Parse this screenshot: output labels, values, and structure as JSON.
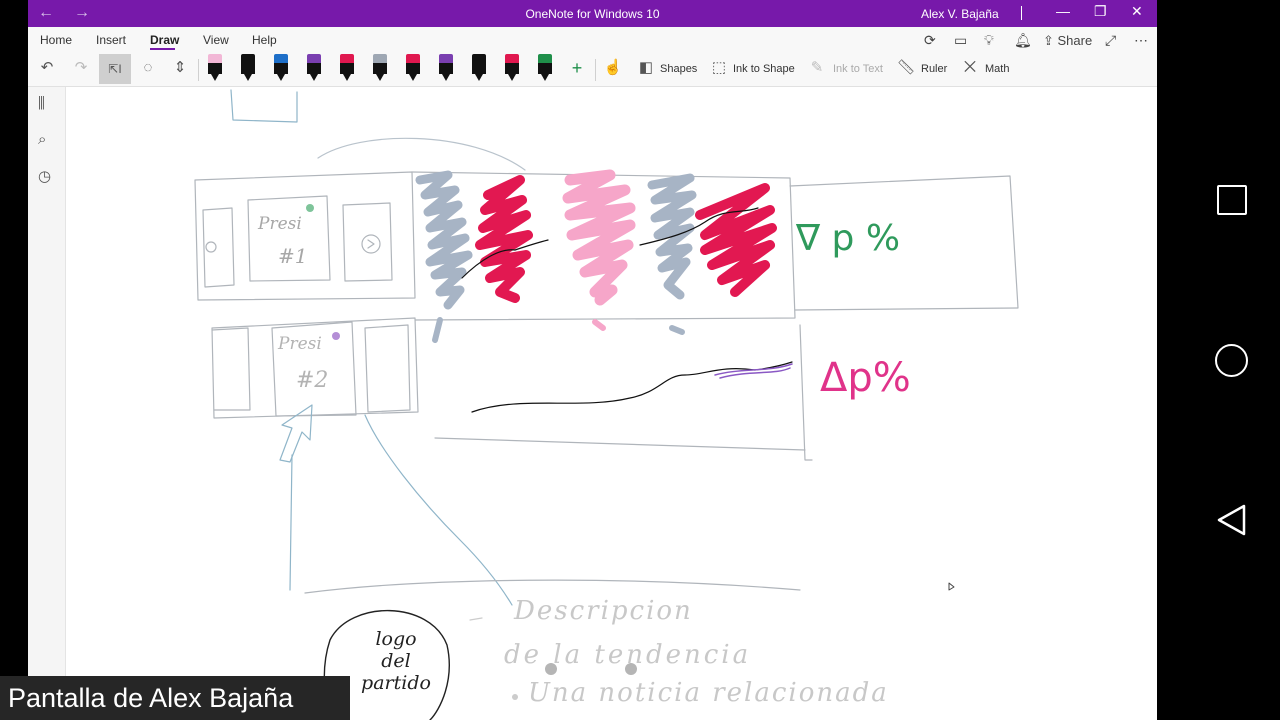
{
  "window": {
    "title": "OneNote for Windows 10",
    "user": "Alex V. Bajaña",
    "back_glyph": "←",
    "forward_glyph": "→",
    "minimize_glyph": "—",
    "restore_glyph": "❐",
    "close_glyph": "✕"
  },
  "ribbon": {
    "tabs": [
      "Home",
      "Insert",
      "Draw",
      "View",
      "Help"
    ],
    "active_tab": "Draw",
    "share_label": "Share",
    "commands": {
      "shapes": "Shapes",
      "ink_to_shape": "Ink to Shape",
      "ink_to_text": "Ink to Text",
      "ruler": "Ruler",
      "math": "Math"
    },
    "pen_colors": [
      "#f2b7d6",
      "#111111",
      "#1e6fc8",
      "#7a3fb0",
      "#e0184f",
      "#9ea7b3",
      "#e0184f",
      "#7a3fb0",
      "#111111",
      "#e0184f",
      "#1f8f4a"
    ]
  },
  "sketch": {
    "card1_title": "Presi",
    "card1_number": "#1",
    "card2_title": "Presi",
    "card2_number": "#2",
    "nabla_label": "∇ p %",
    "delta_label": "Δp%",
    "logo_text": [
      "logo",
      "del",
      "partido"
    ],
    "desc_line1": "Descripcion",
    "desc_line2": "de la tendencia",
    "desc_line3": "Una noticia relacionada"
  },
  "overlay_caption": "Pantalla de Alex Bajaña"
}
